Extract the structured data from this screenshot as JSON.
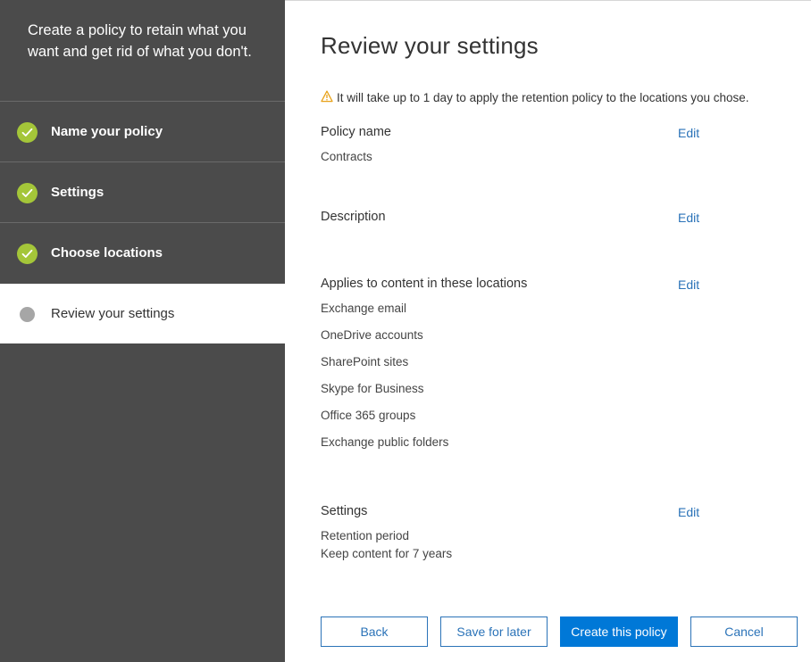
{
  "sidebar": {
    "heading": "Create a policy to retain what you want and get rid of what you don't.",
    "steps": [
      {
        "label": "Name your policy",
        "status": "complete"
      },
      {
        "label": "Settings",
        "status": "complete"
      },
      {
        "label": "Choose locations",
        "status": "complete"
      },
      {
        "label": "Review your settings",
        "status": "current"
      }
    ]
  },
  "main": {
    "title": "Review your settings",
    "warning": "It will take up to 1 day to apply the retention policy to the locations you chose.",
    "edit_label": "Edit",
    "policy_name": {
      "title": "Policy name",
      "value": "Contracts"
    },
    "description": {
      "title": "Description"
    },
    "locations": {
      "title": "Applies to content in these locations",
      "items": [
        "Exchange email",
        "OneDrive accounts",
        "SharePoint sites",
        "Skype for Business",
        "Office 365 groups",
        "Exchange public folders"
      ]
    },
    "settings": {
      "title": "Settings",
      "line1": "Retention period",
      "line2": "Keep content for 7 years"
    }
  },
  "buttons": {
    "back": "Back",
    "save_for_later": "Save for later",
    "create": "Create this policy",
    "cancel": "Cancel"
  },
  "colors": {
    "sidebar_bg": "#4b4b4b",
    "check_green": "#a4c639",
    "link_blue": "#2b73b8",
    "primary_blue": "#0078d7",
    "warning_orange": "#e8a21a"
  },
  "icons": {
    "step_complete": "checkmark-circle-icon",
    "step_current": "current-step-dot-icon",
    "warning": "warning-triangle-icon"
  }
}
